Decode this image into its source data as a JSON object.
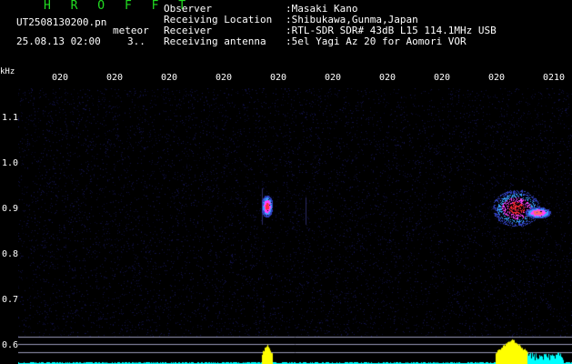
{
  "header": {
    "title": "H R O F F T",
    "file_name": "UT2508130200.pn",
    "file_ext": "meteor",
    "datetime": "25.08.13 02:00",
    "count": "3.."
  },
  "info": [
    {
      "label": "Observer",
      "value": ":Masaki Kano"
    },
    {
      "label": "Receiving Location",
      "value": ":Shibukawa,Gunma,Japan"
    },
    {
      "label": "Receiver",
      "value": ":RTL-SDR SDR# 43dB L15 114.1MHz USB"
    },
    {
      "label": "Receiving antenna",
      "value": ":5el Yagi Az 20 for Aomori VOR"
    }
  ],
  "axis": {
    "y_unit": "kHz",
    "x_ticks": [
      "020",
      "020",
      "020",
      "020",
      "020",
      "020",
      "020",
      "020",
      "020",
      "0210"
    ],
    "y_ticks": [
      "1.1",
      "1.0",
      "0.9",
      "0.8",
      "0.7",
      "0.6"
    ]
  },
  "colors": {
    "background": "#000000",
    "noise": "#0b0b48",
    "title": "#22dd22",
    "level_trace": "#00ffff",
    "level_peak": "#ffff00",
    "echo_hot": "#ff2a3a"
  }
}
